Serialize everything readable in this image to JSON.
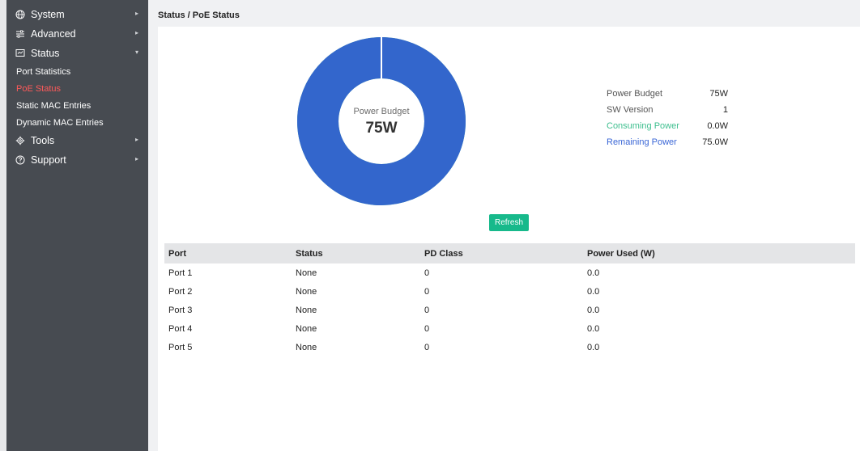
{
  "sidebar": {
    "items": [
      {
        "label": "System",
        "icon": "globe-icon",
        "expanded": false
      },
      {
        "label": "Advanced",
        "icon": "sliders-icon",
        "expanded": false
      },
      {
        "label": "Status",
        "icon": "monitor-icon",
        "expanded": true,
        "children": [
          "Port Statistics",
          "PoE Status",
          "Static MAC Entries",
          "Dynamic MAC Entries"
        ],
        "active_child": "PoE Status"
      },
      {
        "label": "Tools",
        "icon": "gear-icon",
        "expanded": false
      },
      {
        "label": "Support",
        "icon": "help-circle-icon",
        "expanded": false
      }
    ]
  },
  "breadcrumb": "Status / PoE Status",
  "donut": {
    "label": "Power Budget",
    "value": "75W",
    "remaining_fraction": 1.0,
    "color_remaining": "#3366cc",
    "color_consuming": "#3fbf8f"
  },
  "stats": [
    {
      "label": "Power Budget",
      "value": "75W"
    },
    {
      "label": "SW Version",
      "value": "1"
    },
    {
      "label": "Consuming Power",
      "value": "0.0W"
    },
    {
      "label": "Remaining Power",
      "value": "75.0W"
    }
  ],
  "refresh_label": "Refresh",
  "table": {
    "headers": [
      "Port",
      "Status",
      "PD Class",
      "Power Used (W)"
    ],
    "rows": [
      [
        "Port 1",
        "None",
        "0",
        "0.0"
      ],
      [
        "Port 2",
        "None",
        "0",
        "0.0"
      ],
      [
        "Port 3",
        "None",
        "0",
        "0.0"
      ],
      [
        "Port 4",
        "None",
        "0",
        "0.0"
      ],
      [
        "Port 5",
        "None",
        "0",
        "0.0"
      ]
    ]
  }
}
